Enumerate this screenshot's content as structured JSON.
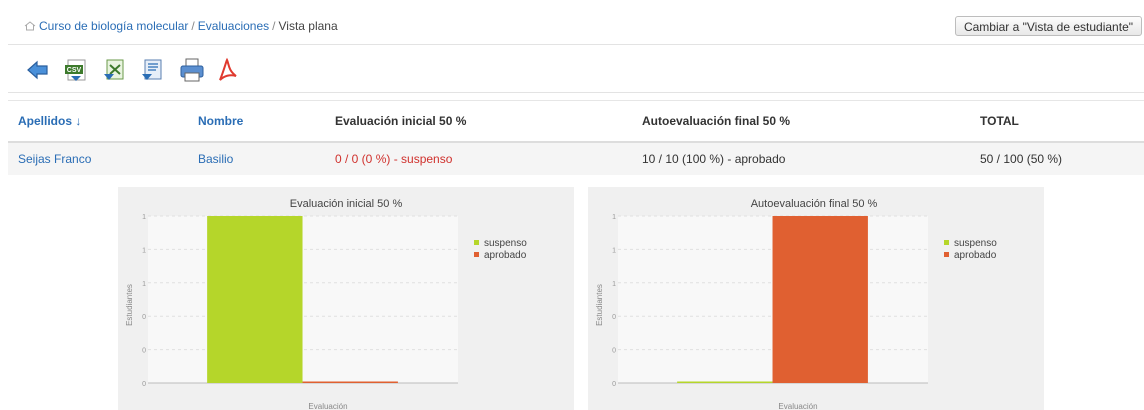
{
  "breadcrumb": {
    "course": "Curso de biología molecular",
    "section": "Evaluaciones",
    "current": "Vista plana"
  },
  "header": {
    "switch_button": "Cambiar a \"Vista de estudiante\""
  },
  "toolbar": {
    "icons": [
      "back-arrow-icon",
      "csv-export-icon",
      "xls-export-icon",
      "doc-export-icon",
      "print-icon",
      "pdf-icon"
    ],
    "csv_text": "CSV"
  },
  "table": {
    "headers": {
      "surname": "Apellidos ↓",
      "name": "Nombre",
      "initial": "Evaluación inicial 50 %",
      "final": "Autoevaluación final 50 %",
      "total": "TOTAL"
    },
    "rows": [
      {
        "surname": "Seijas Franco",
        "name": "Basilio",
        "initial": "0 / 0 (0 %) - suspenso",
        "final": "10 / 10 (100 %) - aprobado",
        "total": "50 / 100 (50 %)"
      }
    ]
  },
  "colors": {
    "link": "#2a6db5",
    "fail": "#d0312d",
    "suspenso": "#b5d62a",
    "aprobado": "#e06031"
  },
  "chart_data": [
    {
      "type": "bar",
      "title": "Evaluación inicial 50 %",
      "ylabel": "Estudiantes",
      "xlabel": "Evaluación",
      "ytick_labels": [
        "1",
        "1",
        "1",
        "0",
        "0",
        "0"
      ],
      "ylim": [
        0,
        1
      ],
      "grid": true,
      "legend_position": "top-right",
      "series": [
        {
          "name": "suspenso",
          "values": [
            1
          ]
        },
        {
          "name": "aprobado",
          "values": [
            0
          ]
        }
      ]
    },
    {
      "type": "bar",
      "title": "Autoevaluación final 50 %",
      "ylabel": "Estudiantes",
      "xlabel": "Evaluación",
      "ytick_labels": [
        "1",
        "1",
        "1",
        "0",
        "0",
        "0"
      ],
      "ylim": [
        0,
        1
      ],
      "grid": true,
      "legend_position": "top-right",
      "series": [
        {
          "name": "suspenso",
          "values": [
            0
          ]
        },
        {
          "name": "aprobado",
          "values": [
            1
          ]
        }
      ]
    }
  ]
}
